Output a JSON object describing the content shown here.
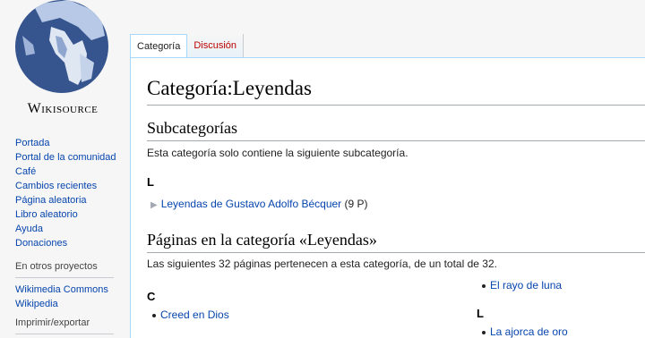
{
  "logo": {
    "text": "Wikisource"
  },
  "navigation": {
    "items": [
      "Portada",
      "Portal de la comunidad",
      "Café",
      "Cambios recientes",
      "Página aleatoria",
      "Libro aleatorio",
      "Ayuda",
      "Donaciones"
    ]
  },
  "other_projects": {
    "heading": "En otros proyectos",
    "items": [
      "Wikimedia Commons",
      "Wikipedia"
    ]
  },
  "print_export": {
    "heading": "Imprimir/exportar"
  },
  "tabs": [
    {
      "label": "Categoría",
      "selected": true
    },
    {
      "label": "Discusión",
      "selected": false
    }
  ],
  "page": {
    "title": "Categoría:Leyendas",
    "subcategories": {
      "heading": "Subcategorías",
      "description": "Esta categoría solo contiene la siguiente subcategoría.",
      "letter": "L",
      "item_label": "Leyendas de Gustavo Adolfo Bécquer",
      "item_count": "(9 P)"
    },
    "pages": {
      "heading": "Páginas en la categoría «Leyendas»",
      "description": "Las siguientes 32 páginas pertenecen a esta categoría, de un total de 32.",
      "col1_letter": "C",
      "col1_items": [
        "Creed en Dios"
      ],
      "col2_items_top": [
        "El rayo de luna"
      ],
      "col2_letter": "L",
      "col2_items": [
        "La ajorca de oro"
      ]
    }
  }
}
